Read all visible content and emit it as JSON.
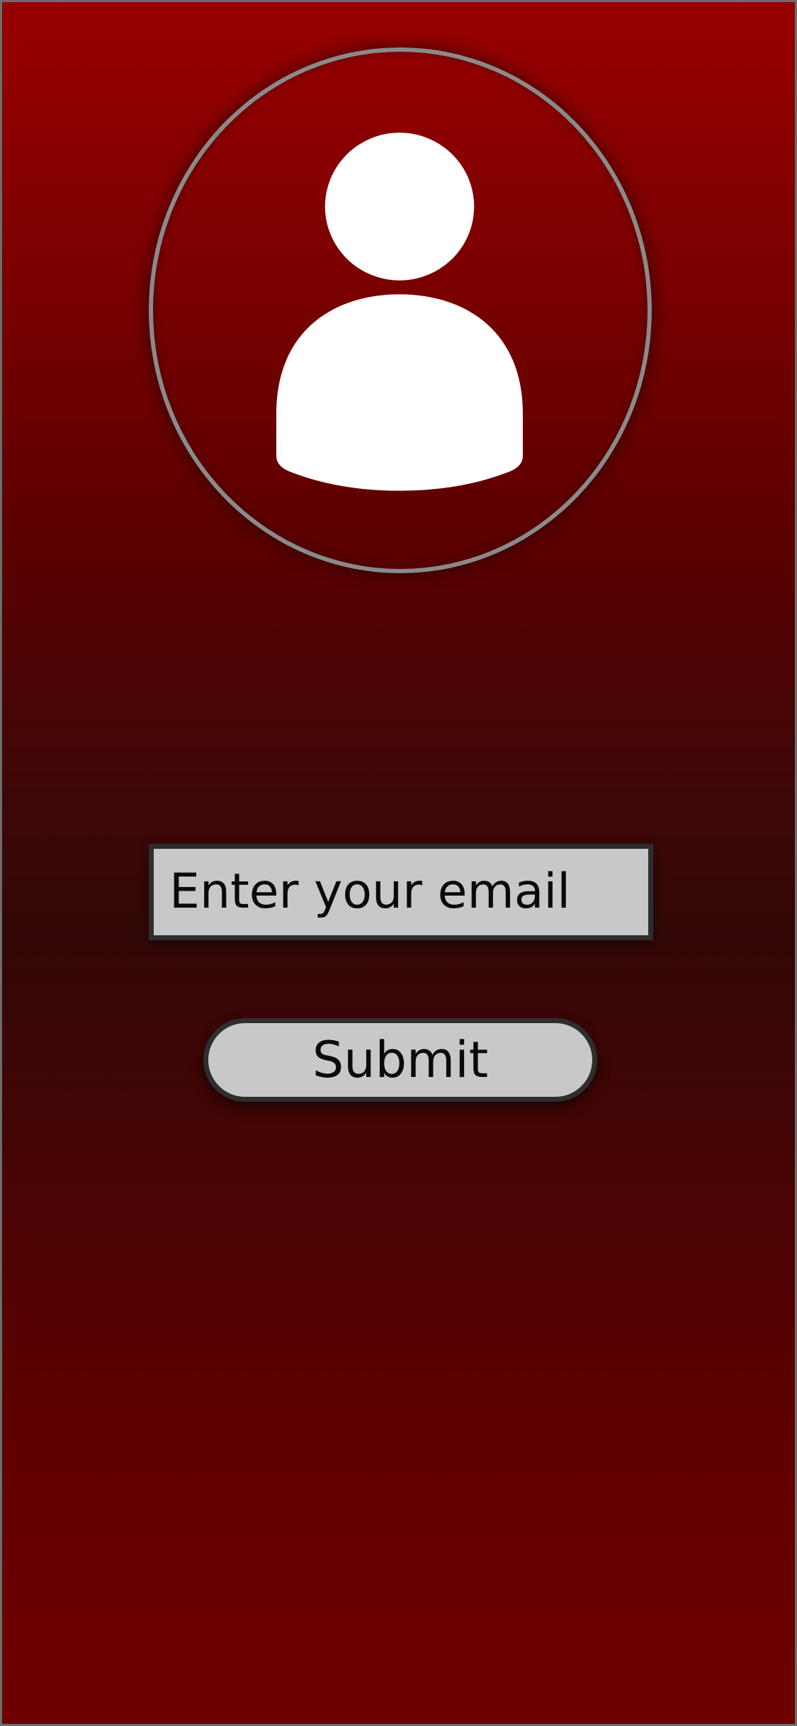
{
  "login": {
    "avatar_icon": "user-icon",
    "email_placeholder": "Enter your email",
    "submit_label": "Submit"
  },
  "colors": {
    "background_top": "#990000",
    "background_middle": "#330707",
    "background_bottom": "#700000",
    "avatar_ring": "#8a8a8a",
    "control_fill": "#c8c8c8",
    "control_border": "#2e2e2e",
    "text": "#0a0a0a",
    "avatar_glyph": "#ffffff"
  }
}
